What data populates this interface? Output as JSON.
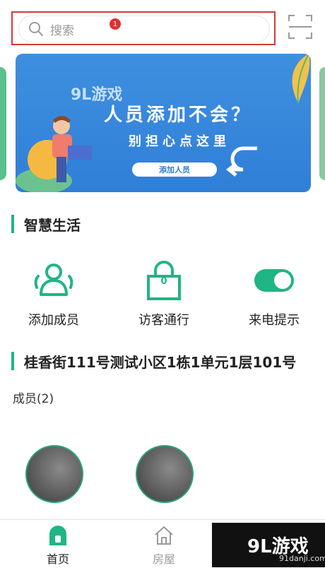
{
  "search": {
    "placeholder": "搜索",
    "badge": "1"
  },
  "banner": {
    "logo": "9L游戏",
    "headline": "人员添加不会？",
    "subline": "别担心点这里",
    "button": "添加人员"
  },
  "section_smart": {
    "title": "智慧生活"
  },
  "features": [
    {
      "label": "添加成员",
      "icon": "people-icon"
    },
    {
      "label": "访客通行",
      "icon": "lock-icon",
      "lock_digit": "0"
    },
    {
      "label": "来电提示",
      "icon": "toggle-icon"
    }
  ],
  "address": {
    "title": "桂香街111号测试小区1栋1单元1层101号"
  },
  "members": {
    "label": "成员(2)"
  },
  "nav": [
    {
      "label": "首页",
      "icon": "home-icon",
      "active": true
    },
    {
      "label": "房屋",
      "icon": "house-icon",
      "active": false
    }
  ],
  "watermark": {
    "brand": "9L游戏",
    "sub": "91danji.com"
  },
  "colors": {
    "accent": "#1fb584",
    "banner": "#3388dd",
    "badge": "#e03030"
  }
}
